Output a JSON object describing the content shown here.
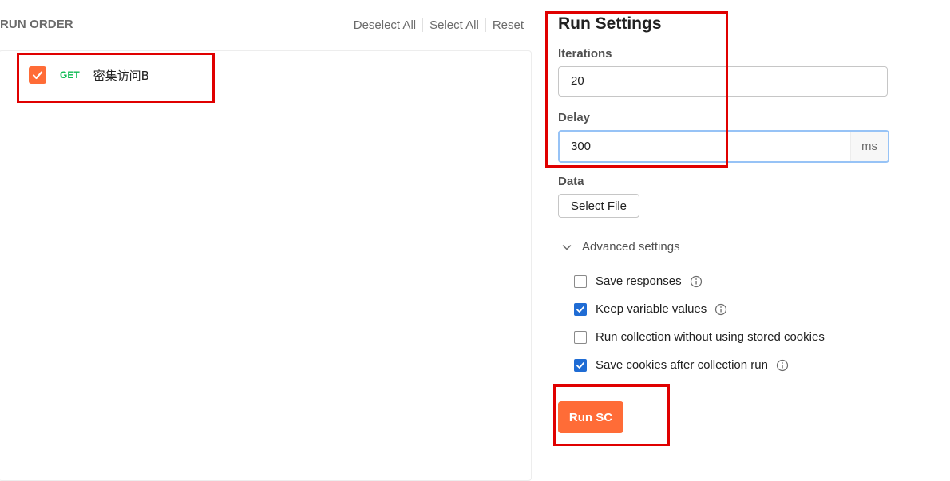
{
  "run_order": {
    "title": "RUN ORDER",
    "actions": {
      "deselect_all": "Deselect All",
      "select_all": "Select All",
      "reset": "Reset"
    },
    "requests": [
      {
        "method": "GET",
        "name": "密集访问B",
        "checked": true
      }
    ]
  },
  "settings": {
    "title": "Run Settings",
    "iterations": {
      "label": "Iterations",
      "value": "20"
    },
    "delay": {
      "label": "Delay",
      "value": "300",
      "unit": "ms"
    },
    "data": {
      "label": "Data",
      "select_file": "Select File"
    },
    "advanced": {
      "label": "Advanced settings",
      "expanded": true,
      "options": [
        {
          "label": "Save responses",
          "checked": false,
          "info": true
        },
        {
          "label": "Keep variable values",
          "checked": true,
          "info": true
        },
        {
          "label": "Run collection without using stored cookies",
          "checked": false,
          "info": false
        },
        {
          "label": "Save cookies after collection run",
          "checked": true,
          "info": true
        }
      ]
    },
    "run_button": "Run SC"
  },
  "colors": {
    "accent": "#ff6c37",
    "get_method": "#0cbb52",
    "checkbox_checked": "#1f6cd4",
    "focus_ring": "#97c3f6",
    "annotation": "#e00000"
  }
}
